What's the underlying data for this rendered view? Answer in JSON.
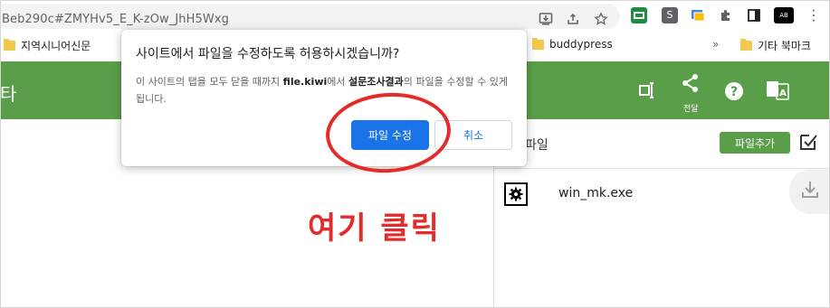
{
  "browser": {
    "url": "Beb290c#ZMYHv5_E_K-zOw_JhH5Wxg",
    "icons": [
      "install-icon",
      "share-icon",
      "star-icon"
    ],
    "extensions": [
      {
        "name": "screen-ext-icon",
        "label": "",
        "color": "#1e8e3e"
      },
      {
        "name": "s-ext-icon",
        "label": "S",
        "color": "#5f6368"
      },
      {
        "name": "gallery-ext-icon",
        "label": "",
        "color": "#e8710a"
      },
      {
        "name": "puzzle-icon",
        "label": "",
        "color": "#5f6368"
      },
      {
        "name": "sidepanel-icon",
        "label": "",
        "color": "#202124"
      },
      {
        "name": "profile-ext-icon",
        "label": "AB",
        "color": "#000000"
      }
    ]
  },
  "bookmarks": {
    "items": [
      {
        "label": "지역시니어신문"
      },
      {
        "label": ""
      },
      {
        "label": "buddypress"
      }
    ],
    "overflow": "»",
    "other": "기타 북마크"
  },
  "header": {
    "left_text": "타",
    "share_label": "전달"
  },
  "dialog": {
    "title": "사이트에서 파일을 수정하도록 허용하시겠습니까?",
    "body_pre": "이 사이트의 탭을 모두 닫을 때까지 ",
    "body_site": "file.kiwi",
    "body_mid": "에서 ",
    "body_file": "설문조사결과",
    "body_post": "의 파일을 수정할 수 있게 됩니다.",
    "confirm_label": "파일 수정",
    "cancel_label": "취소"
  },
  "panel": {
    "title": "파일",
    "add_label": "파일추가",
    "files": [
      {
        "name": "win_mk.exe"
      }
    ]
  },
  "annotation": {
    "text": "여기 클릭",
    "color": "#e52a2a"
  },
  "colors": {
    "header_green": "#5a9e4a",
    "primary_blue": "#1a73e8"
  }
}
